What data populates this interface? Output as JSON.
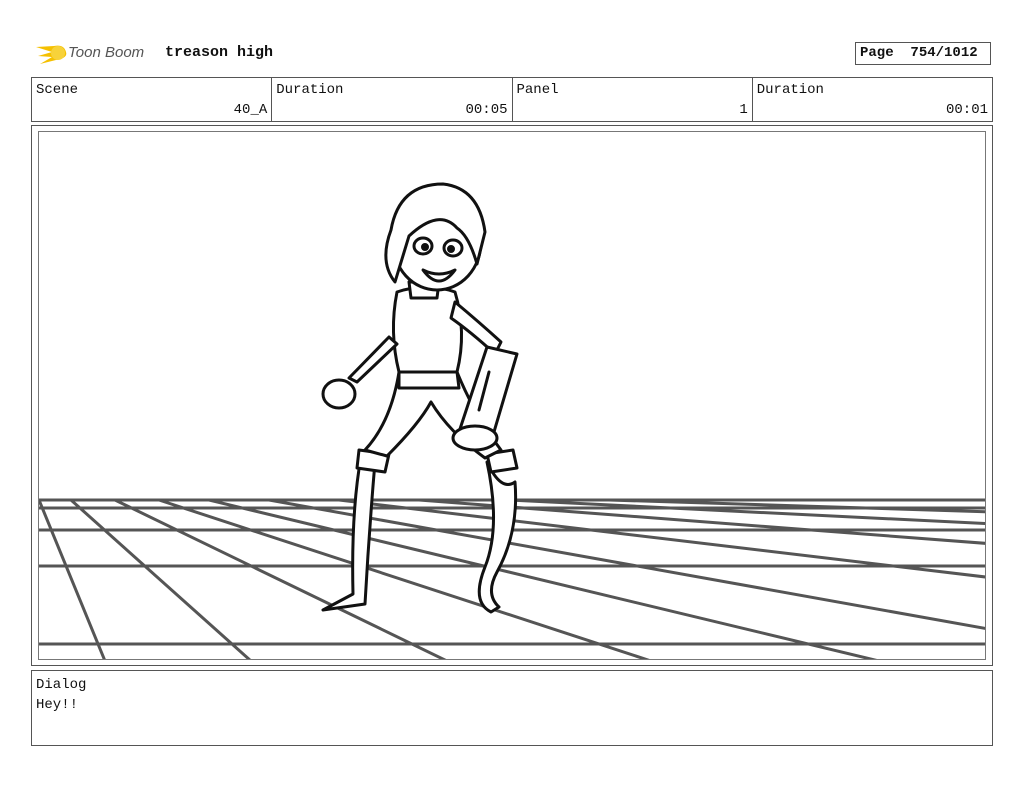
{
  "header": {
    "logo_text": "Toon Boom",
    "project_title": "treason high",
    "page_label": "Page",
    "page_value": "754/1012"
  },
  "info": {
    "scene_label": "Scene",
    "scene_value": "40_A",
    "duration_label": "Duration",
    "duration_value": "00:05",
    "panel_label": "Panel",
    "panel_value": "1",
    "panel_duration_label": "Duration",
    "panel_duration_value": "00:01"
  },
  "dialog": {
    "label": "Dialog",
    "text": "Hey!!"
  },
  "colors": {
    "logo_yellow": "#f5c000",
    "grid_gray": "#555555"
  }
}
